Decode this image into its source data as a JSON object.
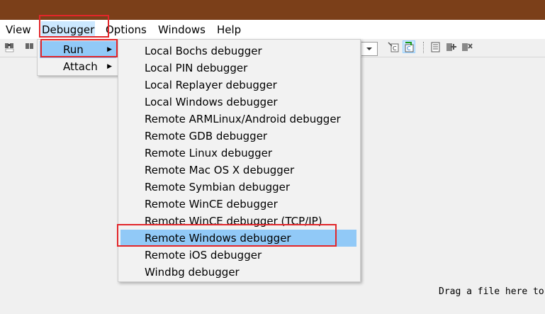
{
  "menubar": {
    "items": [
      "View",
      "Debugger",
      "Options",
      "Windows",
      "Help"
    ]
  },
  "debugger_menu": {
    "items": [
      {
        "label": "Run",
        "has_submenu": true
      },
      {
        "label": "Attach",
        "has_submenu": true
      }
    ]
  },
  "run_submenu": {
    "items": [
      "Local Bochs debugger",
      "Local PIN debugger",
      "Local Replayer debugger",
      "Local Windows debugger",
      "Remote ARMLinux/Android debugger",
      "Remote GDB debugger",
      "Remote Linux debugger",
      "Remote Mac OS X debugger",
      "Remote Symbian debugger",
      "Remote WinCE debugger",
      "Remote WinCE debugger (TCP/IP)",
      "Remote Windows debugger",
      "Remote iOS debugger",
      "Windbg debugger"
    ],
    "highlighted": "Remote Windows debugger"
  },
  "workarea": {
    "hint": "Drag a file here to"
  },
  "colors": {
    "titlebar": "#7b3f19",
    "highlight": "#91c9f7",
    "menubar_active": "#cce8ff",
    "annotation_red": "#e2262a"
  }
}
